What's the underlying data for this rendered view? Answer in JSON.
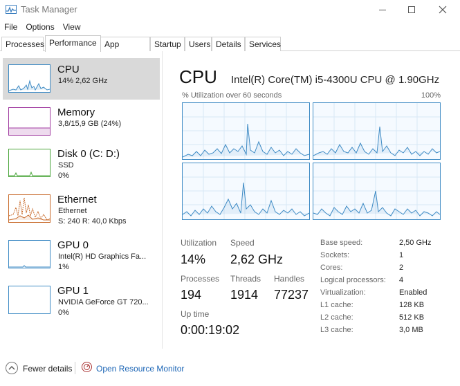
{
  "window": {
    "title": "Task Manager"
  },
  "menu": [
    "File",
    "Options",
    "View"
  ],
  "tabs": [
    {
      "label": "Processes",
      "active": false
    },
    {
      "label": "Performance",
      "active": true
    },
    {
      "label": "App history",
      "active": false
    },
    {
      "label": "Startup",
      "active": false
    },
    {
      "label": "Users",
      "active": false
    },
    {
      "label": "Details",
      "active": false
    },
    {
      "label": "Services",
      "active": false
    }
  ],
  "sidebar": [
    {
      "name": "CPU",
      "lines": [
        "14% 2,62 GHz"
      ],
      "color": "#3d8ac4",
      "selected": true
    },
    {
      "name": "Memory",
      "lines": [
        "3,8/15,9 GB (24%)"
      ],
      "color": "#a03aa0",
      "selected": false
    },
    {
      "name": "Disk 0 (C: D:)",
      "lines": [
        "SSD",
        "0%"
      ],
      "color": "#4aa53a",
      "selected": false
    },
    {
      "name": "Ethernet",
      "lines": [
        "Ethernet",
        "S: 240 R: 40,0 Kbps"
      ],
      "color": "#c86a2a",
      "selected": false
    },
    {
      "name": "GPU 0",
      "lines": [
        "Intel(R) HD Graphics Fa...",
        "1%"
      ],
      "color": "#3d8ac4",
      "selected": false
    },
    {
      "name": "GPU 1",
      "lines": [
        "NVIDIA GeForce GT 720...",
        "0%"
      ],
      "color": "#3d8ac4",
      "selected": false
    }
  ],
  "main": {
    "title": "CPU",
    "model": "Intel(R) Core(TM) i5-4300U CPU @ 1.90GHz",
    "graph_label": "% Utilization over 60 seconds",
    "graph_max": "100%",
    "stats": {
      "utilization_label": "Utilization",
      "utilization": "14%",
      "speed_label": "Speed",
      "speed": "2,62 GHz",
      "processes_label": "Processes",
      "processes": "194",
      "threads_label": "Threads",
      "threads": "1914",
      "handles_label": "Handles",
      "handles": "77237",
      "uptime_label": "Up time",
      "uptime": "0:00:19:02"
    },
    "details": [
      {
        "label": "Base speed:",
        "value": "2,50 GHz"
      },
      {
        "label": "Sockets:",
        "value": "1"
      },
      {
        "label": "Cores:",
        "value": "2"
      },
      {
        "label": "Logical processors:",
        "value": "4"
      },
      {
        "label": "Virtualization:",
        "value": "Enabled"
      },
      {
        "label": "L1 cache:",
        "value": "128 KB"
      },
      {
        "label": "L2 cache:",
        "value": "512 KB"
      },
      {
        "label": "L3 cache:",
        "value": "3,0 MB"
      }
    ]
  },
  "footer": {
    "fewer_details": "Fewer details",
    "open_resource_monitor": "Open Resource Monitor"
  }
}
